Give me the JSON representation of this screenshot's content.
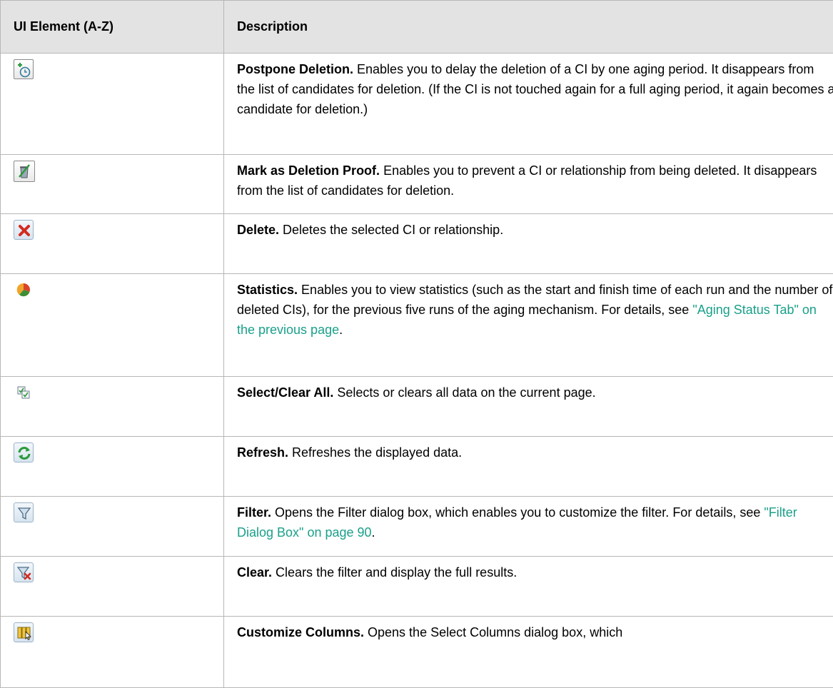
{
  "table": {
    "headers": {
      "element": "UI Element (A-Z)",
      "description": "Description"
    },
    "rows": [
      {
        "icon": "postpone-deletion-icon",
        "title": "Postpone Deletion.",
        "text": " Enables you to delay the deletion of a CI by one aging period. It disappears from the list of candidates for deletion. (If the CI is not touched again for a full aging period, it again becomes a candidate for deletion.)"
      },
      {
        "icon": "deletion-proof-icon",
        "title": "Mark as Deletion Proof.",
        "text": " Enables you to prevent a CI or relationship from being deleted. It disappears from the list of candidates for deletion."
      },
      {
        "icon": "delete-icon",
        "title": "Delete.",
        "text": " Deletes the selected CI or relationship."
      },
      {
        "icon": "statistics-icon",
        "title": "Statistics.",
        "text": " Enables you to view statistics (such as the start and finish time of each run and the number of deleted CIs), for the previous five runs of the aging mechanism. For details, see ",
        "link": "\"Aging Status Tab\" on the previous page",
        "after": "."
      },
      {
        "icon": "select-clear-all-icon",
        "title": "Select/Clear All.",
        "text": " Selects or clears all data on the current page."
      },
      {
        "icon": "refresh-icon",
        "title": "Refresh.",
        "text": " Refreshes the displayed data."
      },
      {
        "icon": "filter-icon",
        "title": "Filter.",
        "text": " Opens the Filter dialog box, which enables you to customize the filter. For details, see ",
        "link": "\"Filter Dialog Box\" on page 90",
        "after": "."
      },
      {
        "icon": "clear-filter-icon",
        "title": "Clear.",
        "text": " Clears the filter and display the full results."
      },
      {
        "icon": "customize-columns-icon",
        "title": "Customize Columns.",
        "text": " Opens the Select Columns dialog box, which"
      }
    ]
  },
  "colors": {
    "link": "#1aa08a",
    "header_bg": "#e3e3e3",
    "border": "#b7b7b7"
  }
}
